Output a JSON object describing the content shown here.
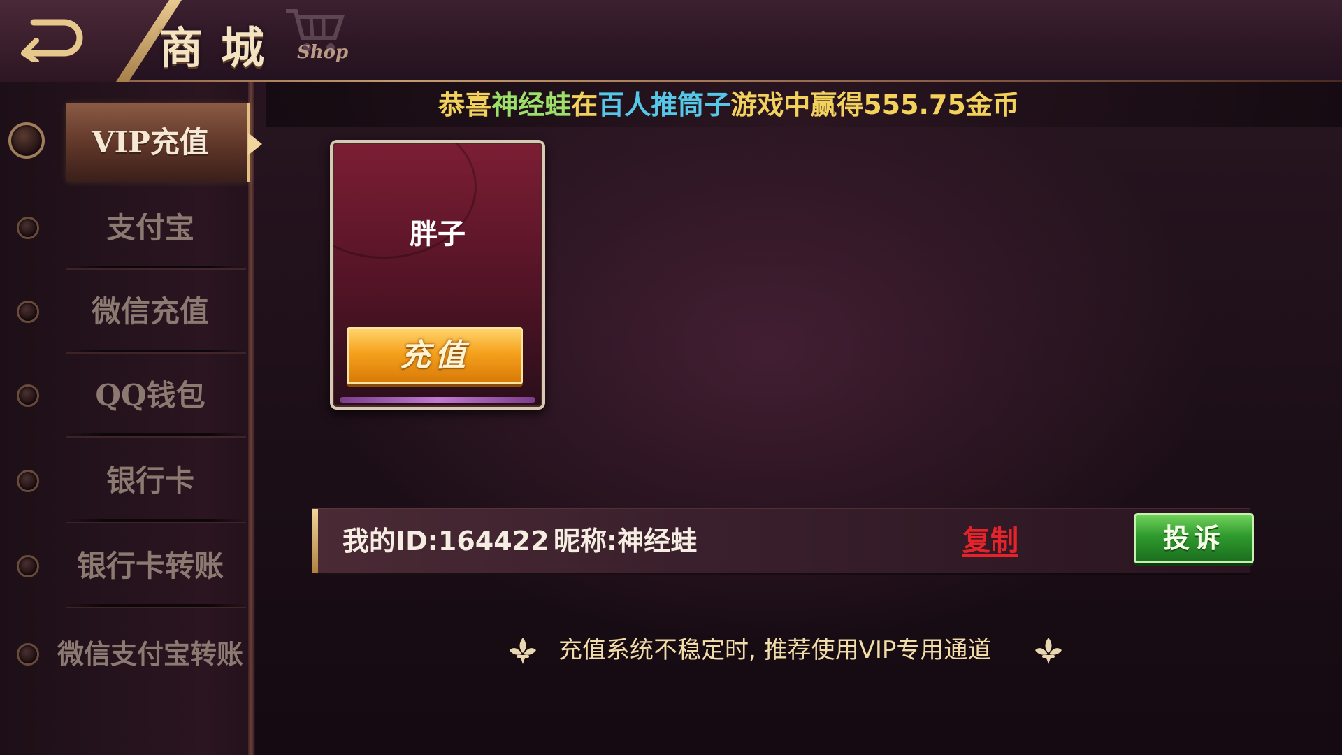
{
  "header": {
    "title": "商城",
    "subtitle": "Shop",
    "back_icon": "back-arrow-icon",
    "cart_icon": "shopping-cart-icon"
  },
  "ticker": {
    "part1": "恭喜",
    "player": "神经蛙",
    "part2": "在",
    "game": "百人推筒子",
    "part3": "游戏中赢得555.75金币"
  },
  "sidebar": {
    "items": [
      {
        "label": "VIP充值",
        "active": true
      },
      {
        "label": "支付宝",
        "active": false
      },
      {
        "label": "微信充值",
        "active": false
      },
      {
        "label": "QQ钱包",
        "active": false
      },
      {
        "label": "银行卡",
        "active": false
      },
      {
        "label": "银行卡转账",
        "active": false
      },
      {
        "label": "微信支付宝转账",
        "active": false
      }
    ]
  },
  "vip_card": {
    "agent_name": "胖子",
    "recharge_label": "充值"
  },
  "account": {
    "id_text": "我的ID:164422",
    "nickname_text": "昵称:神经蛙",
    "copy_label": "复制",
    "complain_label": "投诉"
  },
  "tip": {
    "text": "充值系统不稳定时, 推荐使用VIP专用通道",
    "icon": "fleur-de-lis-icon"
  },
  "colors": {
    "ticker_yellow": "#f3d25b",
    "ticker_green": "#9ce06a",
    "ticker_cyan": "#55c8e8",
    "copy_red": "#e4242a",
    "complain_green": "#2f9a2e",
    "recharge_orange": "#f5a11c"
  }
}
